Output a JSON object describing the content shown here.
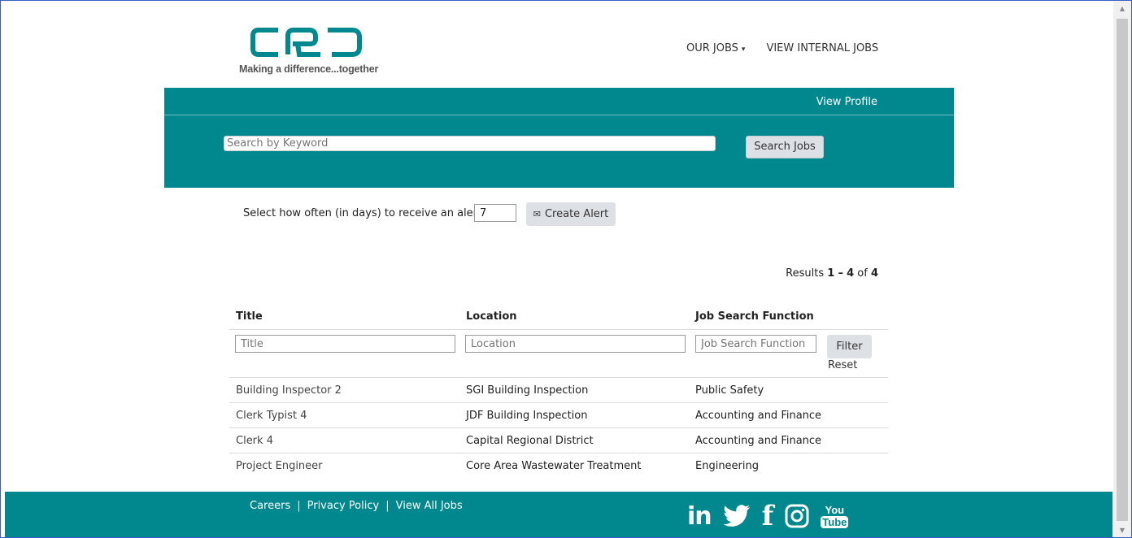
{
  "header": {
    "logo_text": "CRD",
    "tagline": "Making a difference...together",
    "nav": [
      {
        "label": "OUR JOBS",
        "has_dropdown": true
      },
      {
        "label": "VIEW INTERNAL JOBS",
        "has_dropdown": false
      }
    ]
  },
  "search_band": {
    "view_profile": "View Profile",
    "keyword_placeholder": "Search by Keyword",
    "search_button": "Search Jobs",
    "band_color": "#00888f"
  },
  "alert": {
    "label": "Select how often (in days) to receive an alert:",
    "days_value": "7",
    "button": "Create Alert",
    "button_icon": "envelope-icon"
  },
  "results": {
    "prefix": "Results",
    "from": "1",
    "dash": "–",
    "to": "4",
    "of_word": "of",
    "total": "4"
  },
  "table": {
    "headers": [
      "Title",
      "Location",
      "Job Search Function"
    ],
    "filter_placeholders": [
      "Title",
      "Location",
      "Job Search Function"
    ],
    "filter_button": "Filter",
    "reset_link": "Reset",
    "rows": [
      [
        "Building Inspector 2",
        "SGI Building Inspection",
        "Public Safety"
      ],
      [
        "Clerk Typist 4",
        "JDF Building Inspection",
        "Accounting and Finance"
      ],
      [
        "Clerk 4",
        "Capital Regional District",
        "Accounting and Finance"
      ],
      [
        "Project Engineer",
        "Core Area Wastewater Treatment",
        "Engineering"
      ]
    ]
  },
  "footer": {
    "links": [
      "Careers",
      "Privacy Policy",
      "View All Jobs"
    ],
    "separator": "|",
    "social": [
      {
        "icon": "linkedin-icon",
        "text": "in"
      },
      {
        "icon": "twitter-icon",
        "text": ""
      },
      {
        "icon": "facebook-icon",
        "text": "f"
      },
      {
        "icon": "instagram-icon",
        "text": ""
      },
      {
        "icon": "youtube-icon",
        "text_top": "You",
        "text_bottom": "Tube"
      }
    ]
  }
}
